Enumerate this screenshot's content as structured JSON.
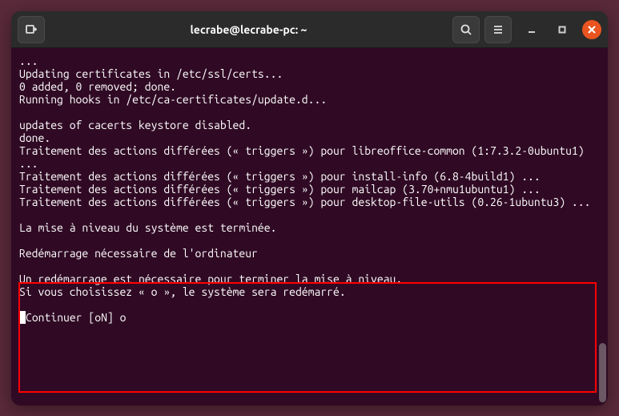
{
  "window": {
    "title": "lecrabe@lecrabe-pc: ~"
  },
  "terminal": {
    "lines": {
      "l0": "...",
      "l1": "Updating certificates in /etc/ssl/certs...",
      "l2": "0 added, 0 removed; done.",
      "l3": "Running hooks in /etc/ca-certificates/update.d...",
      "l4": "",
      "l5": "updates of cacerts keystore disabled.",
      "l6": "done.",
      "l7": "Traitement des actions différées (« triggers ») pour libreoffice-common (1:7.3.2-0ubuntu1) ...",
      "l8": "Traitement des actions différées (« triggers ») pour install-info (6.8-4build1) ...",
      "l9": "Traitement des actions différées (« triggers ») pour mailcap (3.70+nmu1ubuntu1) ...",
      "l10": "Traitement des actions différées (« triggers ») pour desktop-file-utils (0.26-1ubuntu3) ...",
      "l11": "",
      "l12": "La mise à niveau du système est terminée.",
      "l13": "",
      "l14": "Redémarrage nécessaire de l'ordinateur",
      "l15": "",
      "l16": "Un redémarrage est nécessaire pour terminer la mise à niveau.",
      "l17": "Si vous choisissez « o », le système sera redémarré.",
      "l18": "",
      "prompt_label": "Continuer [oN] ",
      "prompt_input": "o"
    }
  }
}
